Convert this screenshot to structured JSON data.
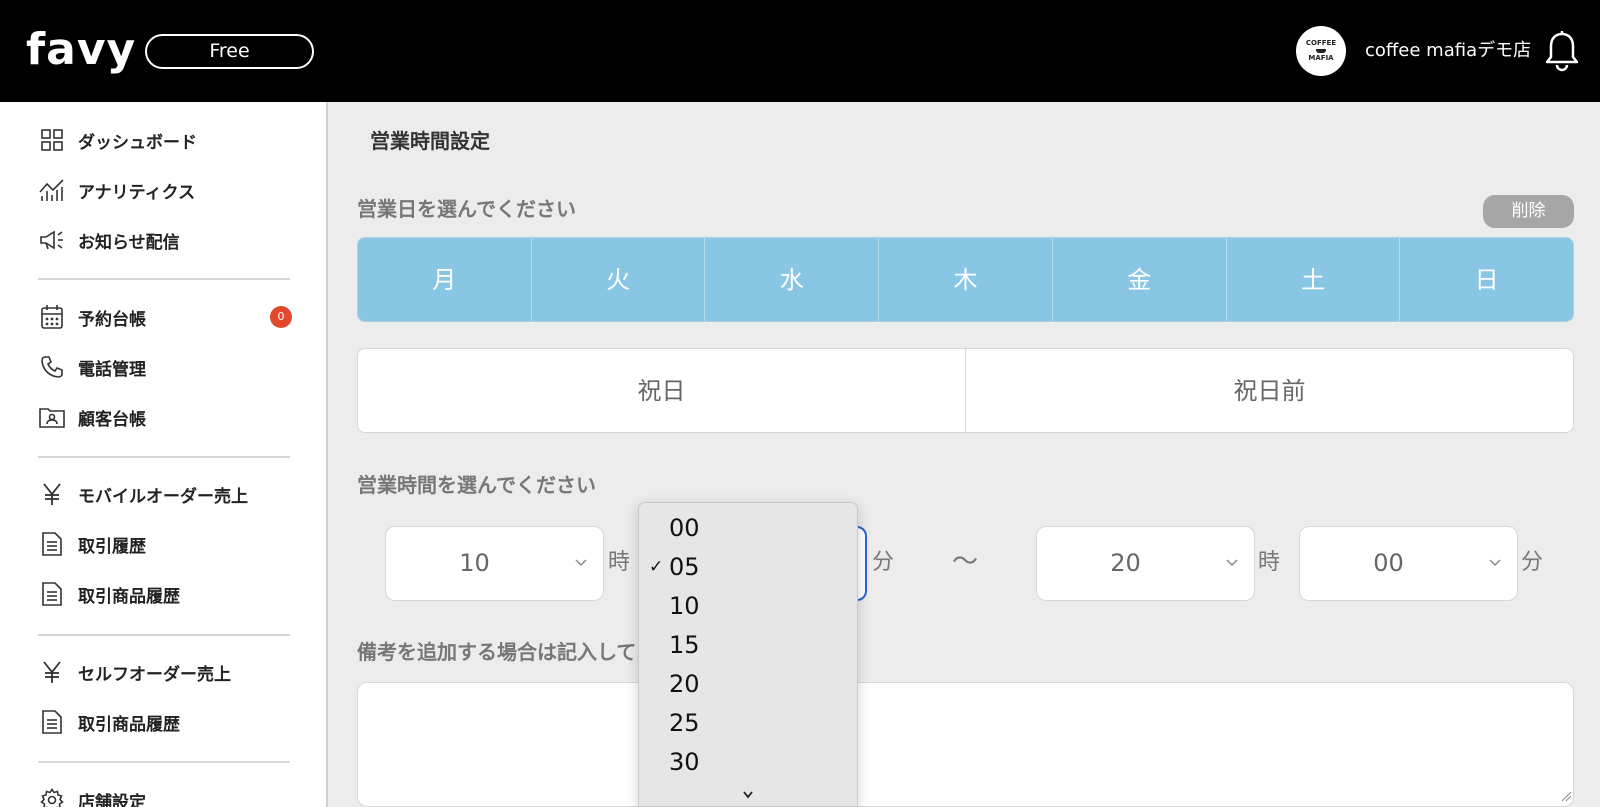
{
  "header": {
    "logo": "favy",
    "plan": "Free",
    "avatar_text_line1": "COFFEE",
    "avatar_text_line2": "MAFIA",
    "store_name": "coffee mafiaデモ店"
  },
  "sidebar": {
    "items": [
      {
        "label": "ダッシュボード",
        "icon": "dashboard-grid-icon"
      },
      {
        "label": "アナリティクス",
        "icon": "analytics-chart-icon"
      },
      {
        "label": "お知らせ配信",
        "icon": "megaphone-icon"
      },
      {
        "label": "予約台帳",
        "icon": "calendar-icon",
        "badge": "0"
      },
      {
        "label": "電話管理",
        "icon": "phone-icon"
      },
      {
        "label": "顧客台帳",
        "icon": "customer-folder-icon"
      },
      {
        "label": "モバイルオーダー売上",
        "icon": "yen-icon"
      },
      {
        "label": "取引履歴",
        "icon": "document-icon"
      },
      {
        "label": "取引商品履歴",
        "icon": "document-icon"
      },
      {
        "label": "セルフオーダー売上",
        "icon": "yen-icon"
      },
      {
        "label": "取引商品履歴",
        "icon": "document-icon"
      },
      {
        "label": "店舗設定",
        "icon": "gear-icon"
      }
    ]
  },
  "main": {
    "title": "営業時間設定",
    "days_label": "営業日を選んでください",
    "delete_label": "削除",
    "weekdays": [
      "月",
      "火",
      "水",
      "木",
      "金",
      "土",
      "日"
    ],
    "holidays": [
      "祝日",
      "祝日前"
    ],
    "hours_label": "営業時間を選んでください",
    "start_hour": "10",
    "hour_unit": "時",
    "minute_unit": "分",
    "separator": "〜",
    "end_hour": "20",
    "end_minute": "00",
    "notes_label": "備考を追加する場合は記入してください"
  },
  "dropdown": {
    "selected": "05",
    "options": [
      "00",
      "05",
      "10",
      "15",
      "20",
      "25",
      "30"
    ]
  },
  "colors": {
    "header_bg": "#000000",
    "weekday_selected": "#89c6e3",
    "badge": "#e0492b",
    "focus": "#2a62d9"
  }
}
